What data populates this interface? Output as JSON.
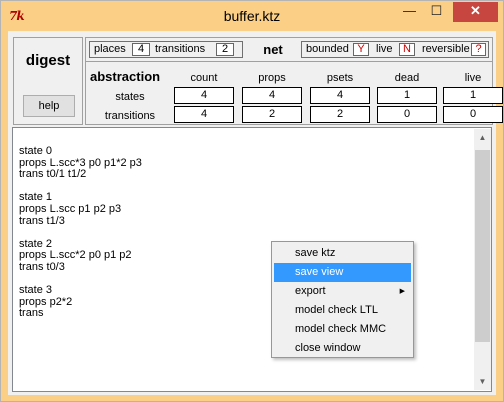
{
  "window": {
    "title": "buffer.ktz",
    "app_icon": "7k",
    "controls": {
      "minimize": "—",
      "maximize": "☐",
      "close": "✕"
    }
  },
  "left": {
    "digest_label": "digest",
    "help_label": "help"
  },
  "net": {
    "places_label": "places",
    "places_value": "4",
    "transitions_label": "transitions",
    "transitions_value": "2",
    "net_label": "net",
    "bounded_label": "bounded",
    "bounded_value": "Y",
    "live_label": "live",
    "live_value": "N",
    "reversible_label": "reversible",
    "reversible_value": "?"
  },
  "abstraction": {
    "title": "abstraction",
    "columns": [
      "count",
      "props",
      "psets",
      "dead",
      "live"
    ],
    "rows": [
      {
        "label": "states",
        "values": [
          "4",
          "4",
          "4",
          "1",
          "1"
        ]
      },
      {
        "label": "transitions",
        "values": [
          "4",
          "2",
          "2",
          "0",
          "0"
        ]
      }
    ]
  },
  "output": {
    "text": "state 0\nprops L.scc*3 p0 p1*2 p3\ntrans t0/1 t1/2\n\nstate 1\nprops L.scc p1 p2 p3\ntrans t1/3\n\nstate 2\nprops L.scc*2 p0 p1 p2\ntrans t0/3\n\nstate 3\nprops p2*2\ntrans"
  },
  "context_menu": {
    "items": [
      {
        "label": "save ktz"
      },
      {
        "label": "save view"
      },
      {
        "label": "export"
      },
      {
        "label": "model check LTL"
      },
      {
        "label": "model check MMC"
      },
      {
        "label": "close window"
      }
    ],
    "highlighted": "save view"
  },
  "colors": {
    "title_bar": "#fbcf85",
    "close_button": "#c7463f",
    "menu_highlight": "#3399ff",
    "flag_text": "#d00000"
  }
}
